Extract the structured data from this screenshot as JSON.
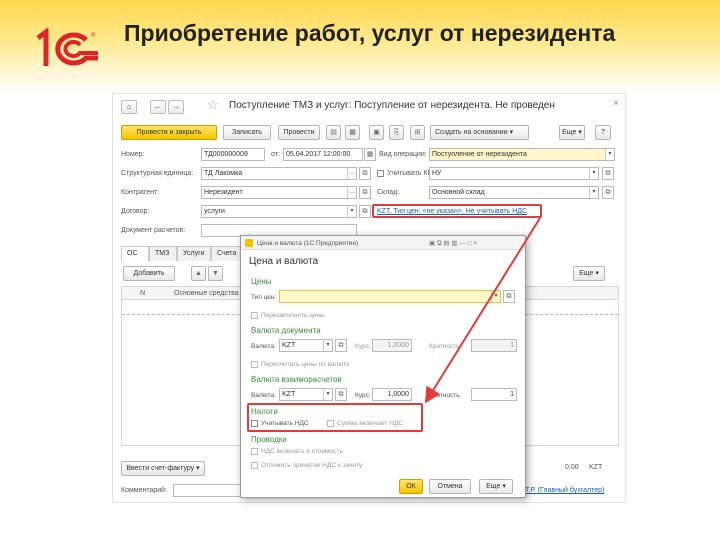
{
  "slide": {
    "title": "Приобретение работ, услуг от нерезидента",
    "accent": "#ffd84d",
    "annotation_color": "#e23b3b"
  },
  "document": {
    "title": "Поступление ТМЗ и услуг: Поступление от нерезидента. Не проведен",
    "toolbar": {
      "post_close": "Провести и закрыть",
      "save": "Записать",
      "post": "Провести",
      "create_based": "Создать на основании",
      "more": "Еще",
      "help": "?"
    },
    "fields": {
      "number_label": "Номер:",
      "number_value": "ТД000000009",
      "from_label": "от:",
      "date_value": "05.04.2017 12:00:00",
      "operation_label": "Вид операции:",
      "operation_value": "Поступление от нерезидента",
      "unit_label": "Структурная единица:",
      "unit_value": "ТД Лакомка",
      "kpn_label": "Учитывать КПН",
      "kpn_value": "НУ",
      "counterparty_label": "Контрагент:",
      "counterparty_value": "Нерезидент",
      "warehouse_label": "Склад:",
      "warehouse_value": "Основной склад",
      "contract_label": "Договор:",
      "contract_value": "услуги",
      "price_link": "KZT, Тип цен: <не указан>, Не учитывать НДС",
      "settlement_label": "Документ расчетов:"
    },
    "tabs": [
      "ОС",
      "ТМЗ",
      "Услуги",
      "Счета"
    ],
    "grid": {
      "add_button": "Добавить",
      "more": "Еще",
      "columns": [
        "N",
        "Основные средства"
      ]
    },
    "footer": {
      "invoice_button": "Ввести счет-фактуру",
      "total": "0.00",
      "currency": "KZT",
      "comment_label": "Комментарий:",
      "responsible_link": "Т.Р. (Главный бухгалтер)"
    }
  },
  "modal": {
    "window_title": "Цена и валюта (1С:Предприятие)",
    "title": "Цена и валюта",
    "prices_section": "Цены",
    "price_type_label": "Тип цен:",
    "refill_prices": "Перезаполнить цены",
    "doc_currency_section": "Валюта документа",
    "currency_label": "Валюта:",
    "currency_value": "KZT",
    "rate_label": "Курс:",
    "rate_value": "1,0000",
    "multiplicity_label": "Кратность:",
    "multiplicity_value": "1",
    "recalc_prices": "Пересчитать цены по валюте",
    "settlement_section": "Валюта взаиморасчетов",
    "currency2_value": "KZT",
    "rate2_value": "1,0000",
    "multiplicity2_value": "1",
    "taxes_section": "Налоги",
    "consider_vat": "Учитывать НДС",
    "sum_includes_vat": "Сумма включает НДС",
    "postings_section": "Проводки",
    "vat_in_cost": "НДС включать в стоимость",
    "defer_vat": "Отложить принятие НДС к зачету",
    "ok": "ОК",
    "cancel": "Отмена",
    "more": "Еще"
  }
}
